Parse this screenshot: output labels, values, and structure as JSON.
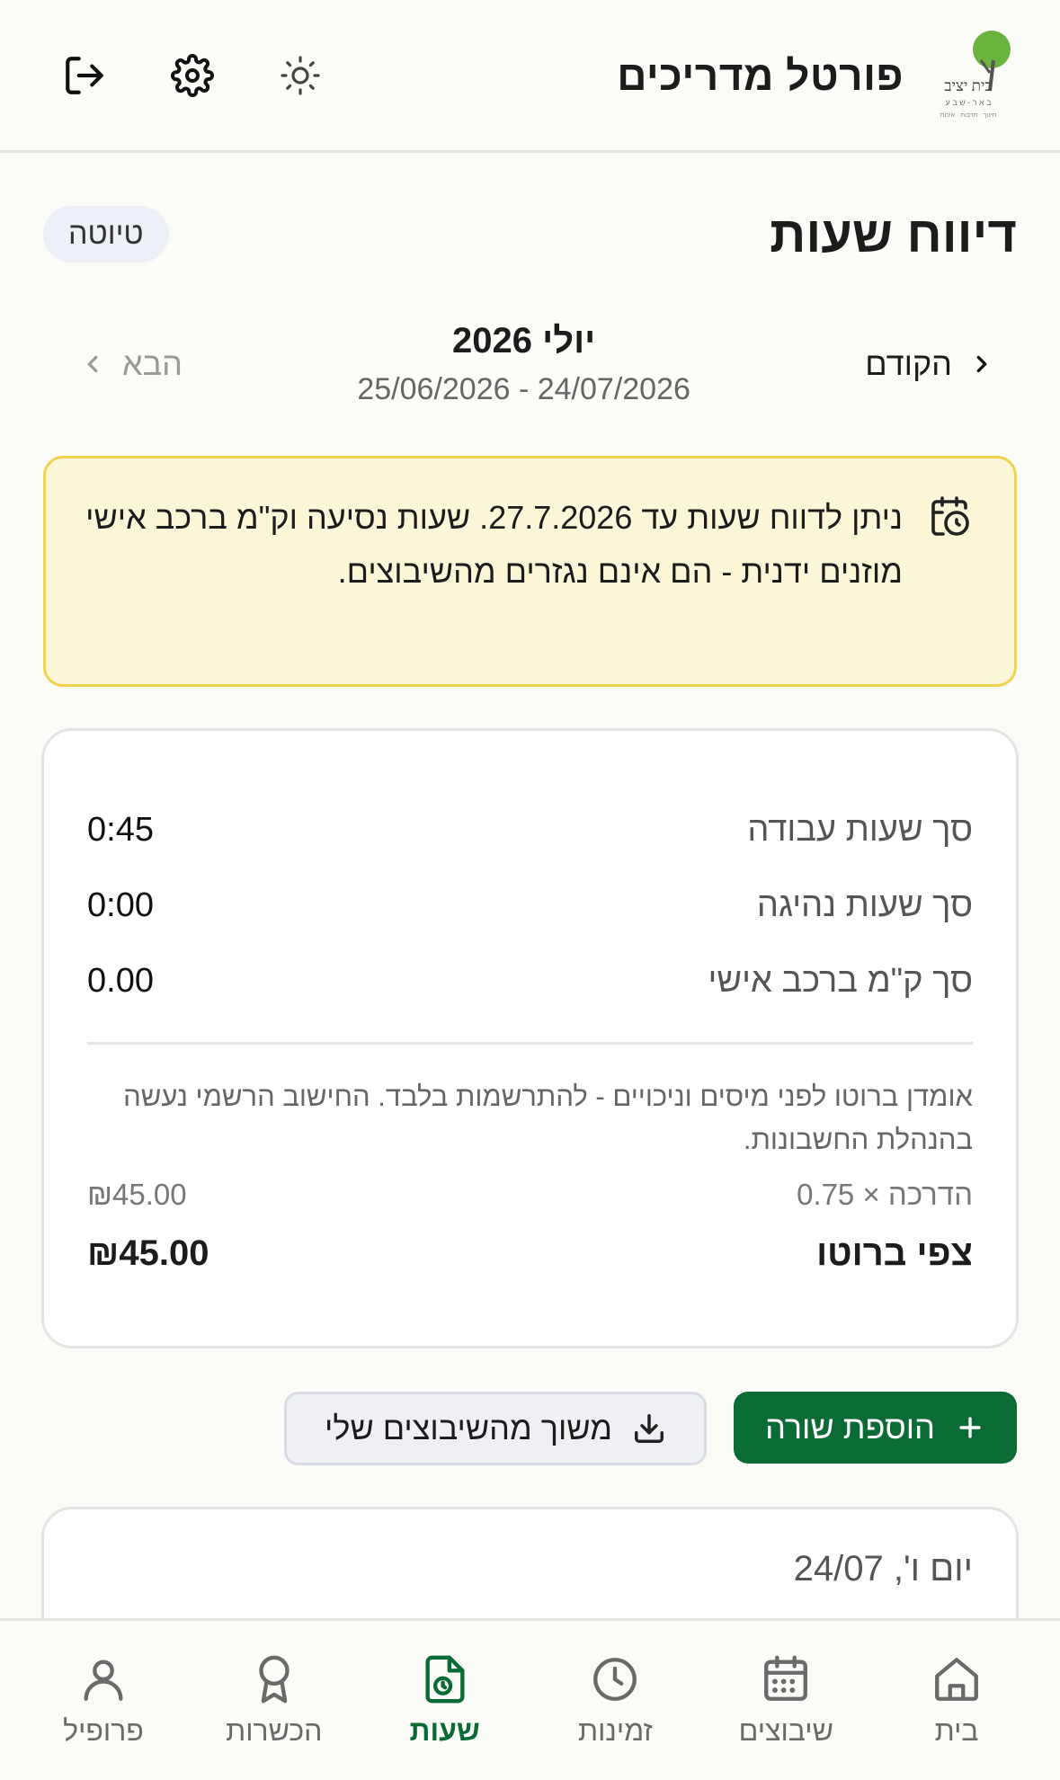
{
  "header": {
    "app_title": "פורטל מדריכים",
    "logo_text": "בית יציב"
  },
  "page": {
    "title": "דיווח שעות",
    "status": "טיוטה"
  },
  "period": {
    "prev_label": "הקודם",
    "next_label": "הבא",
    "month": "יולי 2026",
    "range": "25/06/2026 - 24/07/2026"
  },
  "notice": {
    "text": "ניתן לדווח שעות עד 27.7.2026. שעות נסיעה וק\"מ ברכב אישי מוזנים ידנית - הם אינם נגזרים מהשיבוצים."
  },
  "summary": {
    "rows": [
      {
        "label": "סך שעות עבודה",
        "value": "0:45"
      },
      {
        "label": "סך שעות נהיגה",
        "value": "0:00"
      },
      {
        "label": "סך ק\"מ ברכב אישי",
        "value": "0.00"
      }
    ],
    "disclaimer": "אומדן ברוטו לפני מיסים וניכויים - להתרשמות בלבד. החישוב הרשמי נעשה בהנהלת החשבונות.",
    "calc_label": "הדרכה × 0.75",
    "calc_value": "₪45.00",
    "gross_label": "צפי ברוטו",
    "gross_value": "₪45.00"
  },
  "actions": {
    "add_row": "הוספת שורה",
    "pull_from_schedule": "משוך מהשיבוצים שלי"
  },
  "day": {
    "title": "יום ו', 24/07"
  },
  "nav": [
    {
      "label": "בית",
      "icon": "home-icon"
    },
    {
      "label": "שיבוצים",
      "icon": "calendar-icon"
    },
    {
      "label": "זמינות",
      "icon": "clock-icon"
    },
    {
      "label": "שעות",
      "icon": "timesheet-icon",
      "active": true
    },
    {
      "label": "הכשרות",
      "icon": "award-icon"
    },
    {
      "label": "פרופיל",
      "icon": "user-icon"
    }
  ],
  "colors": {
    "brand_green": "#0b6b35",
    "notice_bg": "#fcf6d9",
    "notice_border": "#f0d34d"
  }
}
